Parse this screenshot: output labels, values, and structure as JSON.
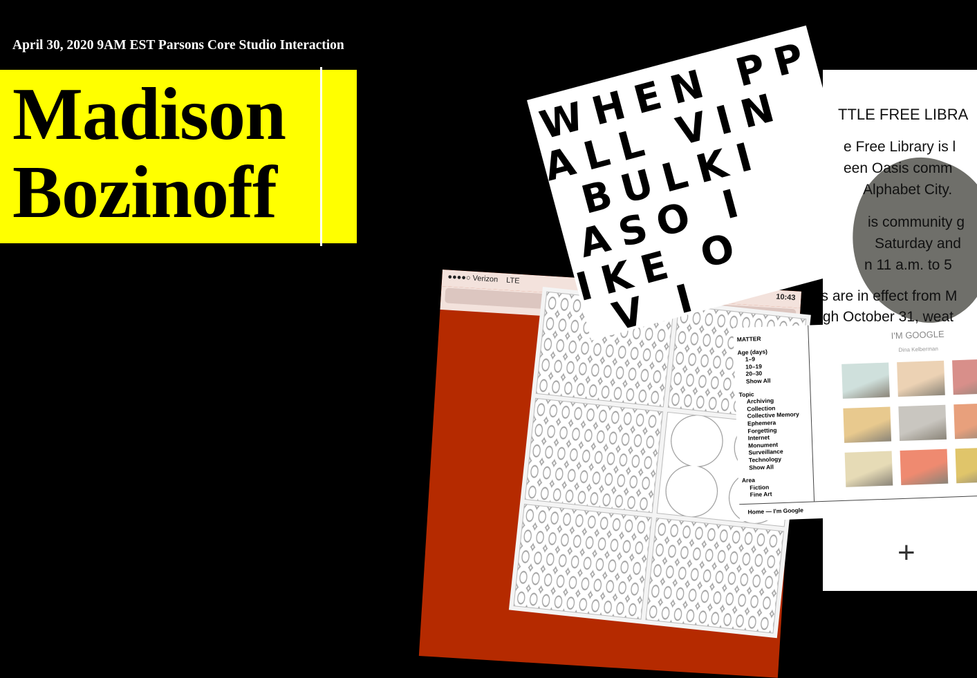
{
  "header": {
    "subtitle": "April 30, 2020 9AM EST Parsons Core Studio Interaction",
    "name_line1": "Madison",
    "name_line2": "Bozinoff",
    "highlight_color": "#ffff00"
  },
  "collage": {
    "phone": {
      "carrier": "●●●●○ Verizon",
      "network": "LTE",
      "time": "10:43",
      "lock_icon": "lock-icon",
      "accent_color": "#b52a00"
    },
    "poster": {
      "rows": [
        "WHEN PP",
        "ALL VIN",
        "BULKI",
        "ASO I",
        "IKE O",
        "V I"
      ]
    },
    "library": {
      "title": "TTLE FREE LIBRA",
      "lines": [
        "e Free Library is l",
        "een Oasis comm",
        "Alphabet City.",
        "is community g",
        "Saturday and",
        "n 11 a.m. to 5",
        "Hours are in effect from M",
        "through October 31, weat"
      ]
    },
    "matter": {
      "brand": "MATTER",
      "sections": [
        {
          "heading": "Age (days)",
          "items": [
            "1–9",
            "10–19",
            "20–30",
            "Show All"
          ]
        },
        {
          "heading": "Topic",
          "items": [
            "Archiving",
            "Collection",
            "Collective Memory",
            "Ephemera",
            "Forgetting",
            "Internet",
            "Monument",
            "Surveillance",
            "Technology",
            "Show All"
          ]
        },
        {
          "heading": "Area",
          "items": [
            "Fiction",
            "Fine Art"
          ]
        }
      ],
      "footer": "Home — I'm Google",
      "title": "I'M GOOGLE",
      "author": "Dina Kelberman",
      "thumb_colors": [
        "#cfe0dc",
        "#ecd2b4",
        "#d88f8a",
        "#e8c98e",
        "#c9c6c0",
        "#e8a07c",
        "#e6dbb6",
        "#ef8a70",
        "#e0c56a"
      ]
    },
    "plus_label": "+"
  }
}
